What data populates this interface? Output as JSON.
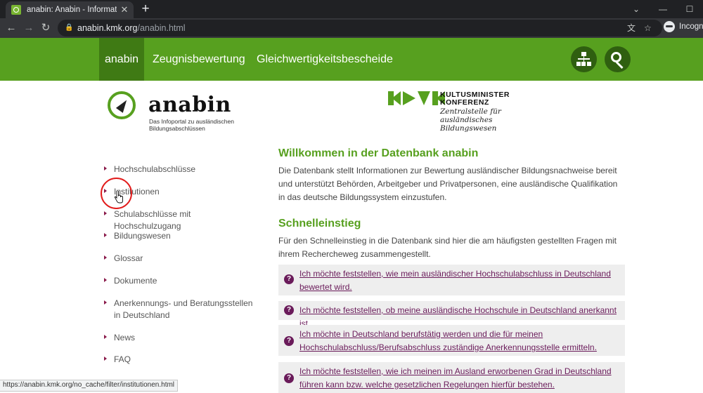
{
  "browser": {
    "tab_title": "anabin: Anabin - Informationssys",
    "url_domain": "anabin.kmk.org",
    "url_path": "/anabin.html",
    "profile_label": "Incognit",
    "status_url": "https://anabin.kmk.org/no_cache/filter/institutionen.html"
  },
  "site_nav": {
    "items": [
      {
        "label": "anabin"
      },
      {
        "label": "Zeugnisbewertung"
      },
      {
        "label": "Gleichwertigkeitsbescheide"
      }
    ]
  },
  "logo": {
    "anabin_word": "anabin",
    "anabin_tagline": "Das Infoportal zu ausländischen Bildungsabschlüssen",
    "kmk_title_line1": "KULTUSMINISTER",
    "kmk_title_line2": "KONFERENZ",
    "kmk_sub": "Zentralstelle für ausländisches Bildungswesen"
  },
  "left_menu": {
    "items": [
      {
        "label": "Hochschulabschlüsse"
      },
      {
        "label": "Institutionen"
      },
      {
        "label": "Schulabschlüsse mit Hochschulzugang"
      },
      {
        "label": "Bildungswesen"
      },
      {
        "label": "Glossar"
      },
      {
        "label": "Dokumente"
      },
      {
        "label": "Anerkennungs- und Beratungsstellen in Deutschland"
      },
      {
        "label": "News"
      },
      {
        "label": "FAQ"
      }
    ]
  },
  "main": {
    "welcome_title": "Willkommen in der Datenbank anabin",
    "welcome_text": "Die Datenbank stellt Informationen zur Bewertung ausländischer Bildungsnachweise bereit und unterstützt Behörden, Arbeitgeber und Privatpersonen, eine ausländische Qualifikation in das deutsche Bildungssystem einzustufen.",
    "quick_title": "Schnelleinstieg",
    "quick_text": "Für den Schnelleinstieg in die Datenbank sind hier die am häufigsten gestellten Fragen mit ihrem Rechercheweg zusammengestellt.",
    "questions": [
      {
        "text": "Ich möchte feststellen, wie mein ausländischer Hochschulabschluss in Deutschland bewertet wird."
      },
      {
        "text": "Ich möchte feststellen, ob meine ausländische Hochschule in Deutschland anerkannt ist."
      },
      {
        "text": "Ich möchte in Deutschland berufstätig werden und die für meinen Hochschulabschluss/Berufsabschluss zuständige Anerkennungsstelle ermitteln."
      },
      {
        "text": "Ich möchte feststellen, wie ich meinen im Ausland erworbenen Grad in Deutschland führen kann bzw. welche gesetzlichen Regelungen hierfür bestehen."
      }
    ],
    "question_icon": "?"
  },
  "colors": {
    "brand_green": "#57a01f",
    "question_purple": "#6a1b5a"
  }
}
